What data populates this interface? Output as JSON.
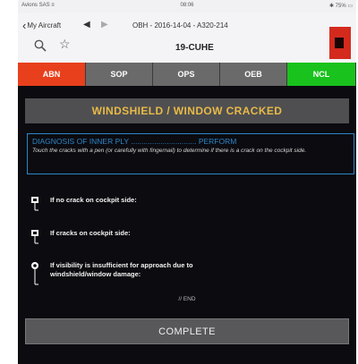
{
  "status_bar": {
    "left": "Avions SAS ≡",
    "center": "08:06",
    "right": "✱ 75% ▭"
  },
  "navbar": {
    "back_label": "My Aircraft",
    "document_title": "OBH - 2016-14-04 - A320-214",
    "tail": "19-CUHE"
  },
  "icons": {
    "back": "chevron-left-icon",
    "prev": "triangle-left-icon",
    "next": "triangle-right-icon",
    "search": "search-icon",
    "bookmark": "star-icon"
  },
  "tabs": [
    {
      "label": "ABN",
      "color": "#e8401c",
      "active": true
    },
    {
      "label": "SOP",
      "color": "#6a6a6a",
      "active": false
    },
    {
      "label": "OPS",
      "color": "#6a6a6a",
      "active": false
    },
    {
      "label": "OEB",
      "color": "#6a6a6a",
      "active": false
    },
    {
      "label": "NCL",
      "color": "#19c21c",
      "active": false
    }
  ],
  "procedure": {
    "title": "WINDSHIELD / WINDOW CRACKED",
    "diagnosis": {
      "heading": "DIAGNOSIS OF INNER PLY",
      "dots": "...............................",
      "action": "PERFORM",
      "description": "Touch the cracks with a pen (or carefully with fingernail) to determine if there is a crack on the cockpit side."
    },
    "conditions": [
      {
        "line1": "If no crack on cockpit side:",
        "line2": ""
      },
      {
        "line1": "If cracks on cockpit side:",
        "line2": ""
      },
      {
        "line1": "If visibility is insufficient for approach due to",
        "line2": "windshield/window damage:"
      }
    ],
    "end_marker": "// END",
    "complete_label": "COMPLETE"
  },
  "colors": {
    "accent_yellow": "#e8ba46",
    "diagnosis_blue": "#2d86c6",
    "background": "#0b0b10"
  }
}
